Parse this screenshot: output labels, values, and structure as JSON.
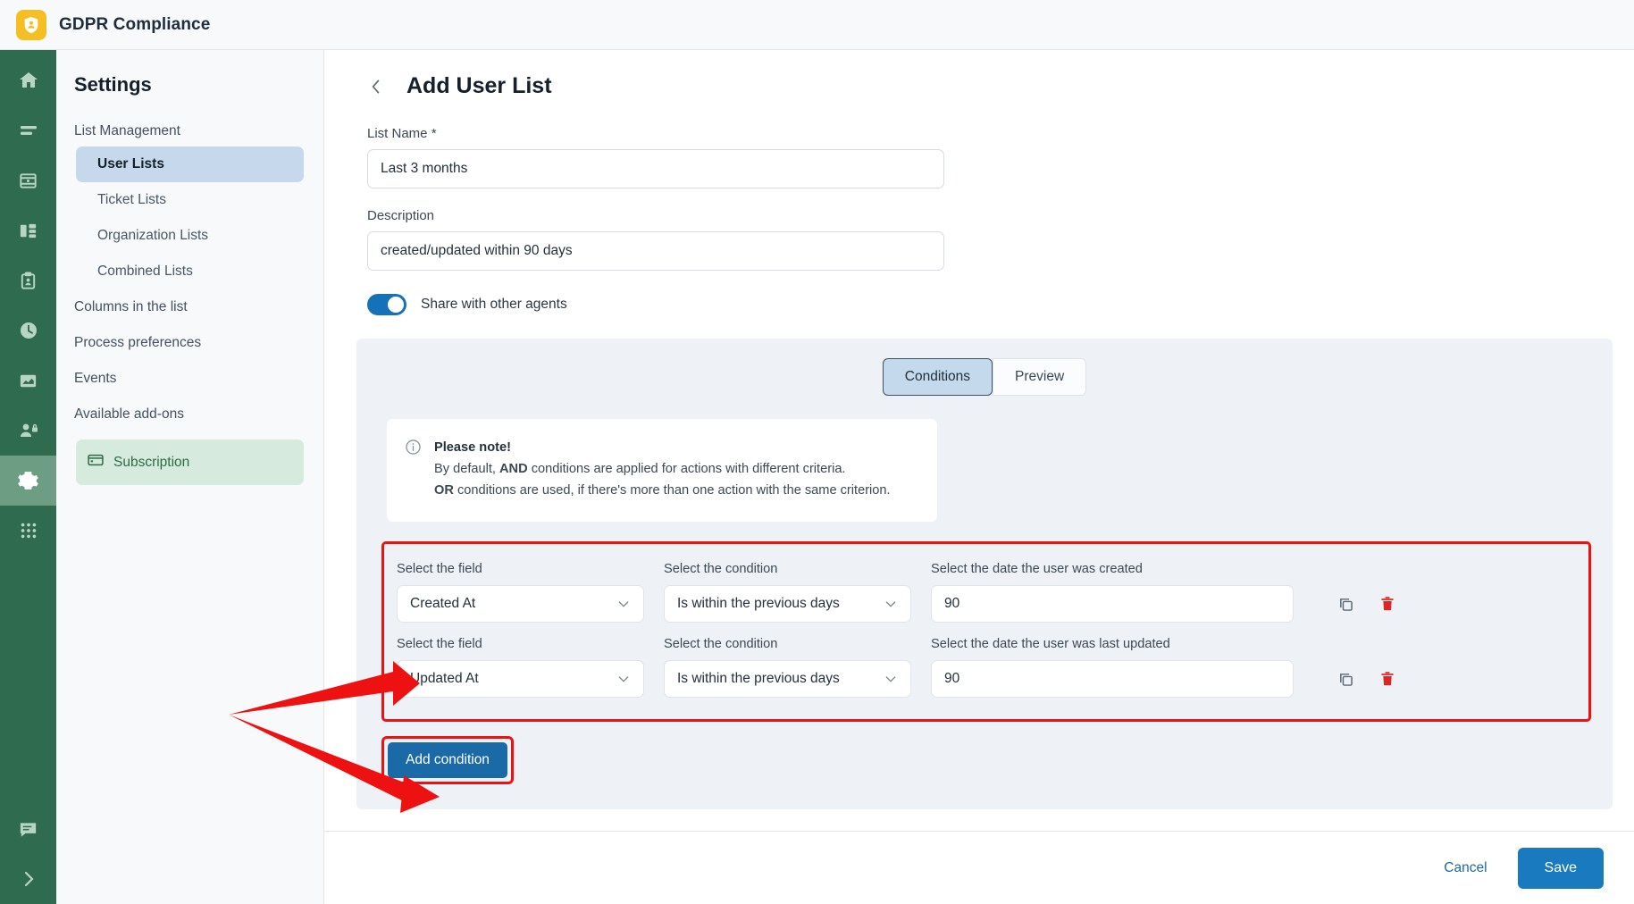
{
  "header": {
    "app_title": "GDPR Compliance",
    "logo_icon": "shield-user-icon"
  },
  "rail": {
    "items": [
      {
        "icon": "home-icon",
        "name": "home",
        "active": false
      },
      {
        "icon": "list-icon",
        "name": "lists",
        "active": false
      },
      {
        "icon": "database-icon",
        "name": "database",
        "active": false
      },
      {
        "icon": "organization-icon",
        "name": "organizations",
        "active": false
      },
      {
        "icon": "clipboard-user-icon",
        "name": "clipboard",
        "active": false
      },
      {
        "icon": "clock-icon",
        "name": "history",
        "active": false
      },
      {
        "icon": "chart-icon",
        "name": "reports",
        "active": false
      },
      {
        "icon": "user-lock-icon",
        "name": "privacy",
        "active": false
      },
      {
        "icon": "gear-icon",
        "name": "settings",
        "active": true
      },
      {
        "icon": "apps-grid-icon",
        "name": "apps",
        "active": false
      }
    ],
    "bottom_items": [
      {
        "icon": "chat-icon",
        "name": "chat"
      },
      {
        "icon": "chevron-right-icon",
        "name": "expand"
      }
    ]
  },
  "settings": {
    "title": "Settings",
    "group_label": "List Management",
    "sub_items": [
      {
        "label": "User Lists",
        "active": true
      },
      {
        "label": "Ticket Lists",
        "active": false
      },
      {
        "label": "Organization Lists",
        "active": false
      },
      {
        "label": "Combined Lists",
        "active": false
      }
    ],
    "items": [
      {
        "label": "Columns in the list"
      },
      {
        "label": "Process preferences"
      },
      {
        "label": "Events"
      },
      {
        "label": "Available add-ons"
      }
    ],
    "subscription": {
      "label": "Subscription",
      "icon": "credit-card-icon"
    }
  },
  "page": {
    "back_icon": "chevron-left-icon",
    "title": "Add User List",
    "list_name": {
      "label": "List Name *",
      "value": "Last 3 months",
      "placeholder": "List Name"
    },
    "description": {
      "label": "Description",
      "value": "created/updated within 90 days",
      "placeholder": "Description"
    },
    "share_toggle": {
      "label": "Share with other agents",
      "on": true
    }
  },
  "conditions_panel": {
    "tabs": [
      {
        "label": "Conditions",
        "active": true
      },
      {
        "label": "Preview",
        "active": false
      }
    ],
    "note": {
      "icon": "info-icon",
      "title": "Please note!",
      "line1_pre": "By default, ",
      "line1_bold": "AND",
      "line1_post": " conditions are applied for actions with different criteria.",
      "line2_bold": "OR",
      "line2_post": " conditions are used, if there's more than one action with the same criterion."
    },
    "rows": [
      {
        "field_label": "Select the field",
        "field_value": "Created At",
        "condition_label": "Select the condition",
        "condition_value": "Is within the previous days",
        "value_label": "Select the date the user was created",
        "value": "90",
        "copy_icon": "copy-icon",
        "delete_icon": "trash-icon"
      },
      {
        "field_label": "Select the field",
        "field_value": "Updated At",
        "condition_label": "Select the condition",
        "condition_value": "Is within the previous days",
        "value_label": "Select the date the user was last updated",
        "value": "90",
        "copy_icon": "copy-icon",
        "delete_icon": "trash-icon"
      }
    ],
    "add_condition_label": "Add condition"
  },
  "footer": {
    "cancel_label": "Cancel",
    "save_label": "Save"
  },
  "colors": {
    "rail_green": "#2f6b4f",
    "rail_active": "#6d9e84",
    "accent_blue": "#1a7ac0",
    "annotation_red": "#ee1111",
    "logo_yellow": "#f5bf24",
    "selected_nav": "#c6d9ec",
    "subscription_green": "#d6ebdd"
  }
}
